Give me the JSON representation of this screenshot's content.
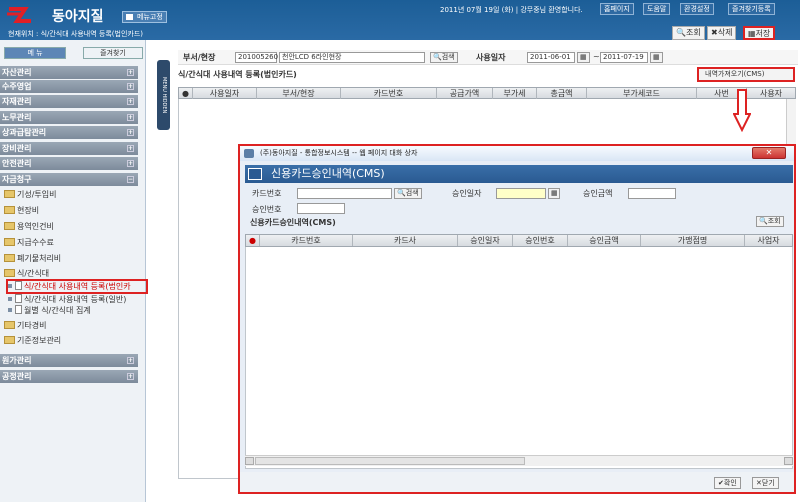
{
  "header": {
    "app_title": "동아지질",
    "menu_fix": "메뉴고정",
    "greeting": "2011년 07월 19일 (화) | 강무중님 환영합니다.",
    "top_buttons": [
      "홈페이지",
      "도움말",
      "환경설정",
      "즐겨찾기등록"
    ],
    "location": "현재위치 : 식/간식대 사용내역 등록(법인카드)",
    "toolbar": [
      "조회",
      "삭제",
      "저장"
    ]
  },
  "sidebar": {
    "menu_btn": "메 뉴",
    "fav_btn": "즐겨찾기",
    "categories_top": [
      "자산관리",
      "수주영업",
      "자재관리",
      "노무관리",
      "상과급탐관리",
      "장비관리",
      "안전관리",
      "자금청구"
    ],
    "tree_items": [
      "기성/투입비",
      "현장비",
      "용역인건비",
      "지급수수료",
      "폐기물처리비",
      "식/간식대"
    ],
    "sub_items": [
      "식/간식대 사용내역 등록(법인카",
      "식/간식대 사용내역 등록(일반)",
      "월별 식/간식대 집계"
    ],
    "tree_items2": [
      "기타경비",
      "기준정보관리"
    ],
    "categories_bottom": [
      "원가관리",
      "공정관리"
    ]
  },
  "vtab": "MENU HIDDEN",
  "search": {
    "site_label": "부서/현장",
    "site_code": "201005260",
    "site_name": "천안LCD 6라인현장",
    "search_btn": "검색",
    "date_label": "사용일자",
    "date_from": "2011-06-01",
    "date_to": "2011-07-19",
    "tilde": "~"
  },
  "section_title": "식/간식대 사용내역 등록(법인카드)",
  "load_btn": "내역가져오기(CMS)",
  "grid_columns": [
    "사용일자",
    "부서/현장",
    "카드번호",
    "공급가액",
    "부가세",
    "총금액",
    "부가세코드",
    "사번",
    "사용자"
  ],
  "dialog": {
    "title": "(주)동아지질 - 통합정보시스템 -- 웹 페이지 대화 상자",
    "banner": "신용카드승인내역(CMS)",
    "card_label": "카드번호",
    "search_btn": "검색",
    "approve_date_label": "승인일자",
    "approve_amount_label": "승인금액",
    "approve_no_label": "승인번호",
    "sub_title": "신용카드승인내역(CMS)",
    "query_btn": "조회",
    "columns": [
      "카드번호",
      "카드사",
      "승인일자",
      "승인번호",
      "승인금액",
      "가맹점명",
      "사업자"
    ],
    "confirm_btn": "확인",
    "close_btn": "닫기"
  },
  "colors": {
    "header": "#1c5e97",
    "highlight": "#dd2222"
  }
}
